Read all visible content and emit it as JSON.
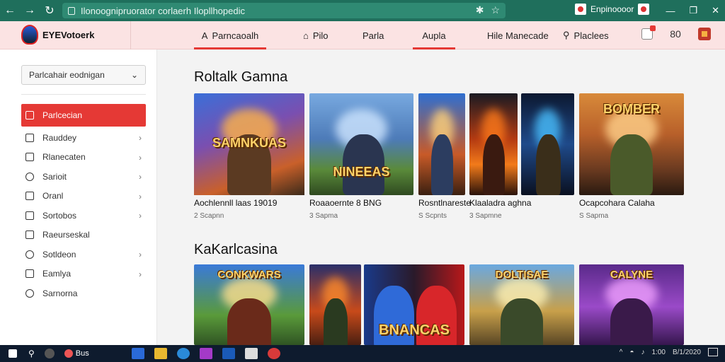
{
  "browser": {
    "address": "Ilonoognipruorator corlaerh Ilopllhopedic",
    "profile_name": "Enpinoooor"
  },
  "header": {
    "logo_text": "EYEVotoerk",
    "tabs": [
      {
        "label": "Parncaoalh",
        "icon": "A"
      },
      {
        "label": "Pilo",
        "icon": "bell"
      },
      {
        "label": "Parla",
        "icon": ""
      },
      {
        "label": "Aupla",
        "icon": ""
      },
      {
        "label": "Hile Manecade",
        "icon": ""
      },
      {
        "label": "Placlees",
        "icon": "user"
      }
    ],
    "badge": "80"
  },
  "sidebar": {
    "select_value": "Parlcahair   eodnigan",
    "items": [
      {
        "label": "Parlcecian"
      },
      {
        "label": "Rauddey"
      },
      {
        "label": "Rlanecaten"
      },
      {
        "label": "Sarioit"
      },
      {
        "label": "Oranl"
      },
      {
        "label": "Sortobos"
      },
      {
        "label": "Raeurseskal"
      },
      {
        "label": "Sotldeon"
      },
      {
        "label": "Eamlya"
      },
      {
        "label": "Sarnorna"
      }
    ]
  },
  "main": {
    "sections": [
      {
        "title": "Roltalk Gamna",
        "cards": [
          {
            "art_title": "SAMNKUAS",
            "name": "Aochlennll laas 19019",
            "sub": "2 Scapnn"
          },
          {
            "art_title": "NINEEAS",
            "name": "Roaaoernte 8 BNG",
            "sub": "3 Sapma"
          },
          {
            "art_title": "",
            "name": "Rosntlnareste",
            "sub": "S Scpnts"
          },
          {
            "art_title": "",
            "name": "Klaaladra aghna",
            "sub": "3 Sapmne"
          },
          {
            "art_title": "",
            "name": "",
            "sub": ""
          },
          {
            "art_title": "BOMBER",
            "name": "Ocapcohara Calaha",
            "sub": "S Sapma"
          }
        ]
      },
      {
        "title": "KaKarlcasina",
        "cards": [
          {
            "art_title": "CONKWARS"
          },
          {
            "art_title": ""
          },
          {
            "art_title": "BNANCAS"
          },
          {
            "art_title": "DOLTISAE"
          },
          {
            "art_title": "CALYNE"
          }
        ]
      }
    ]
  },
  "taskbar": {
    "app_label": "Bus",
    "tray_time": "1:00",
    "tray_date": "B/1/2020"
  }
}
